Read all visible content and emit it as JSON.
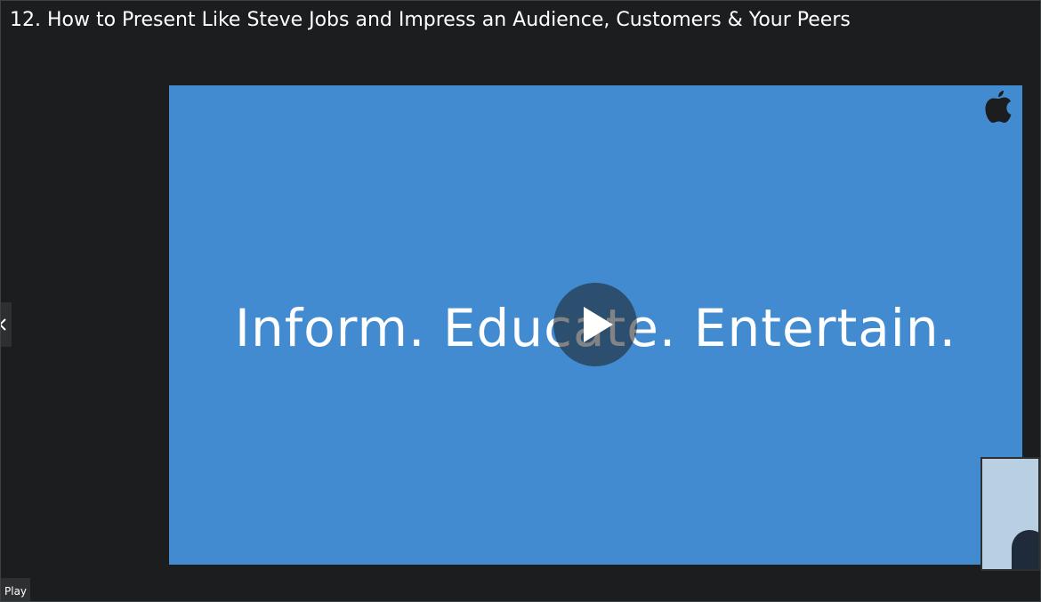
{
  "lecture": {
    "title": "12. How to Present Like Steve Jobs and Impress an Audience, Customers & Your Peers"
  },
  "video": {
    "slide_text": "Inform. Educate. Entertain.",
    "background_color": "#428bd0",
    "logo_icon": "apple-logo-icon",
    "play_icon": "play-icon",
    "prev_icon": "chevron-left-icon"
  },
  "controls": {
    "play_tooltip": "Play"
  }
}
